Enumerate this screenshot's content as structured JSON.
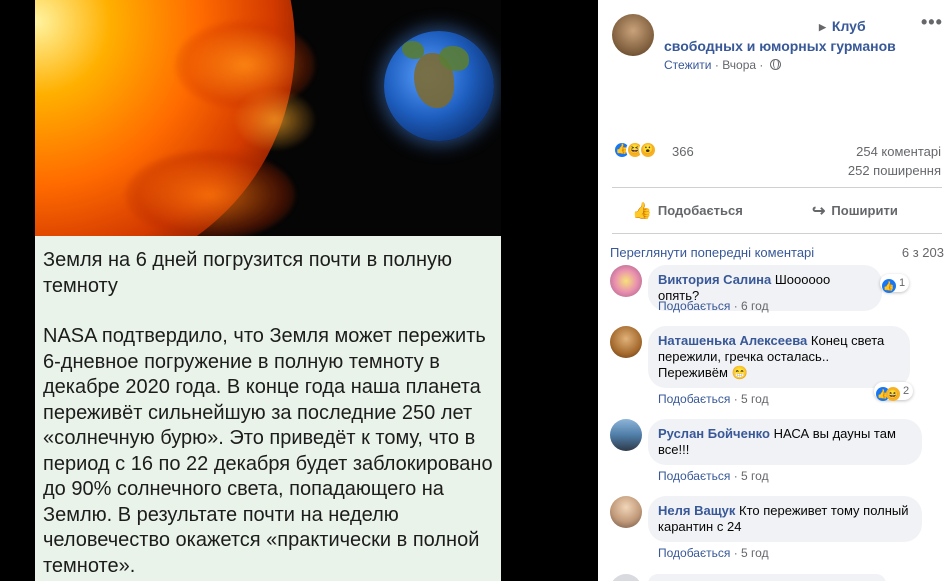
{
  "photo": {
    "headline": "Земля на 6 дней погрузится почти в полную темноту",
    "body": "NASA подтвердило, что Земля может пережить 6-дневное погружение в полную темноту в декабре 2020 года. В конце года наша планета переживёт сильнейшую за последние 250 лет «солнечную бурю». Это приведёт к тому, что в период с 16 по 22 декабря будет заблокировано до 90% солнечного света, попадающего на Землю. В результате почти на неделю человечество окажется «практически в полной темноте»."
  },
  "post": {
    "group_name": "Клуб свободных и юморных гурманов",
    "follow_label": "Стежити",
    "time": "Вчора",
    "reactions_count": "366",
    "comments_count": "254 коментарі",
    "shares_count": "252 поширення",
    "like_action": "Подобається",
    "share_action": "Поширити",
    "more_icon": "more-options-icon"
  },
  "comments_section": {
    "view_previous": "Переглянути попередні коментарі",
    "shown_of_total": "6 з 203"
  },
  "comments": [
    {
      "author": "Виктория Салина",
      "text": "Шоооооо опять?",
      "like_label": "Подобається",
      "time": "6 год",
      "reaction_count": "1"
    },
    {
      "author": "Наташенька Алексеева",
      "text": "Конец света пережили, гречка осталась.. Переживём 😁",
      "like_label": "Подобається",
      "time": "5 год",
      "reaction_count": "2"
    },
    {
      "author": "Руслан Бойченко",
      "text": "НАСА вы дауны там все!!!",
      "like_label": "Подобається",
      "time": "5 год"
    },
    {
      "author": "Неля Ващук",
      "text": "Кто переживет тому полный карантин с 24",
      "like_label": "Подобається",
      "time": "5 год"
    }
  ],
  "colors": {
    "link": "#385898",
    "muted": "#65676b",
    "bubble": "#f0f2f5",
    "like_blue": "#1877f2"
  }
}
